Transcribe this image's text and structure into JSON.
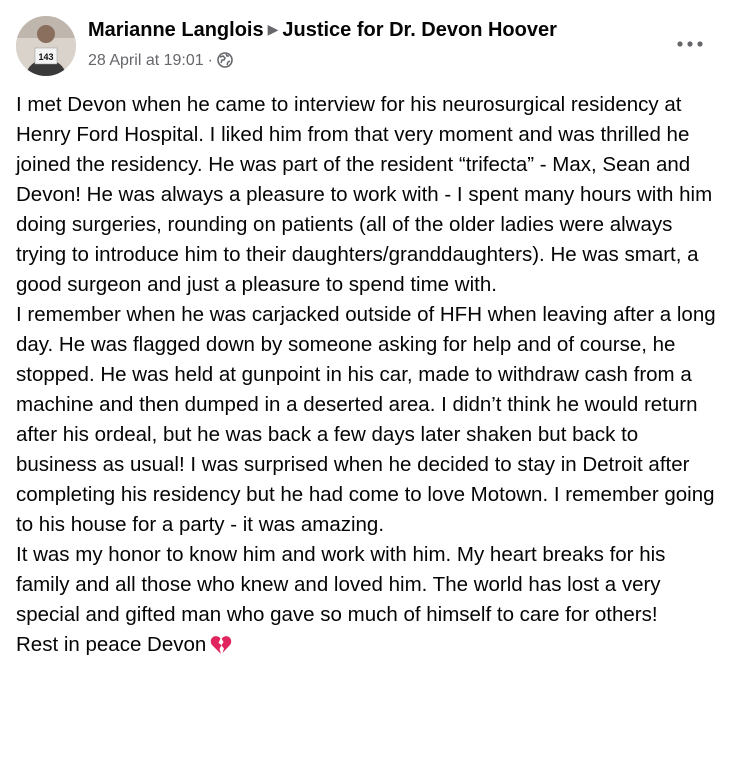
{
  "post": {
    "author": "Marianne Langlois",
    "group": "Justice for Dr. Devon Hoover",
    "timestamp": "28 April at 19:01",
    "audience_icon": "globe-icon",
    "more_icon": "more-options-icon",
    "paragraphs": [
      "I met Devon when he came to interview for his neurosurgical residency at Henry Ford Hospital. I liked him from that very moment and was thrilled he joined the residency. He was part of the resident “trifecta” - Max, Sean and Devon!  He was always a pleasure to work with - I spent many hours with him doing surgeries, rounding on patients (all of the older ladies were always trying to introduce him to their daughters/granddaughters). He was smart, a good surgeon and just a pleasure to spend time with.",
      "I remember when he was carjacked outside of HFH when leaving after a long day. He was flagged down by someone asking for help and of course, he stopped. He was held at gunpoint in his car, made to withdraw cash from a machine and then dumped in a deserted area.  I didn’t think he would return after his ordeal, but he was back a few days later shaken but back to business as usual!  I was surprised when he decided to stay in Detroit after completing his residency but he had come to love Motown.  I remember going to his house for a party - it was amazing.",
      "It was my honor to know him and work with him.  My heart breaks for his family and all those who knew and loved him.  The world has lost a very special and gifted man who gave so much of himself to care for others!",
      "Rest in peace Devon"
    ],
    "closing_emoji": "broken-heart-icon",
    "colors": {
      "text": "#050505",
      "secondary": "#65676b",
      "heart": "#e0245e"
    }
  }
}
